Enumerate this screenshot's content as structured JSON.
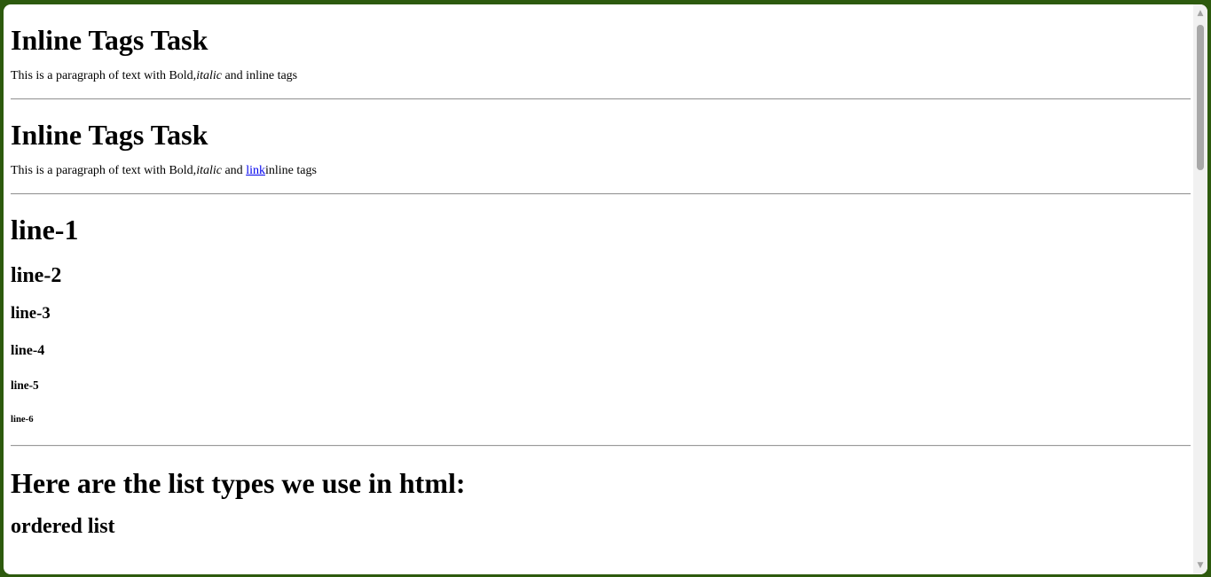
{
  "section1": {
    "heading": "Inline Tags Task",
    "text_before": "This is a paragraph of text with Bold,",
    "italic": "italic",
    "text_after": " and inline tags"
  },
  "section2": {
    "heading": "Inline Tags Task",
    "text_before": "This is a paragraph of text with Bold,",
    "italic": "italic",
    "text_middle": " and ",
    "link": "link",
    "text_after": "inline tags"
  },
  "headings": {
    "h1": "line-1",
    "h2": "line-2",
    "h3": "line-3",
    "h4": "line-4",
    "h5": "line-5",
    "h6": "line-6"
  },
  "lists": {
    "title": "Here are the list types we use in html:",
    "ordered_title": "ordered list"
  },
  "scrollbar": {
    "up_icon": "▲",
    "down_icon": "▼"
  }
}
